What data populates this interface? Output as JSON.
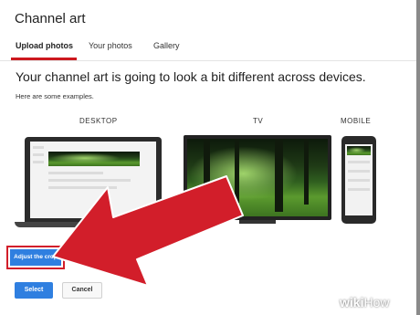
{
  "dialog": {
    "title": "Channel art",
    "tabs": [
      {
        "label": "Upload photos",
        "active": true
      },
      {
        "label": "Your photos",
        "active": false
      },
      {
        "label": "Gallery",
        "active": false
      }
    ],
    "headline": "Your channel art is going to look a bit different across devices.",
    "subtext": "Here are some examples.",
    "devices": {
      "desktop": "DESKTOP",
      "tv": "TV",
      "mobile": "MOBILE"
    },
    "buttons": {
      "adjust_crop": "Adjust the crop",
      "select": "Select",
      "cancel": "Cancel"
    }
  },
  "watermark": {
    "prefix": "wiki",
    "suffix": "How"
  },
  "colors": {
    "accent": "#cc181e",
    "primary_button": "#2f7fe0",
    "arrow": "#d21e2a"
  }
}
